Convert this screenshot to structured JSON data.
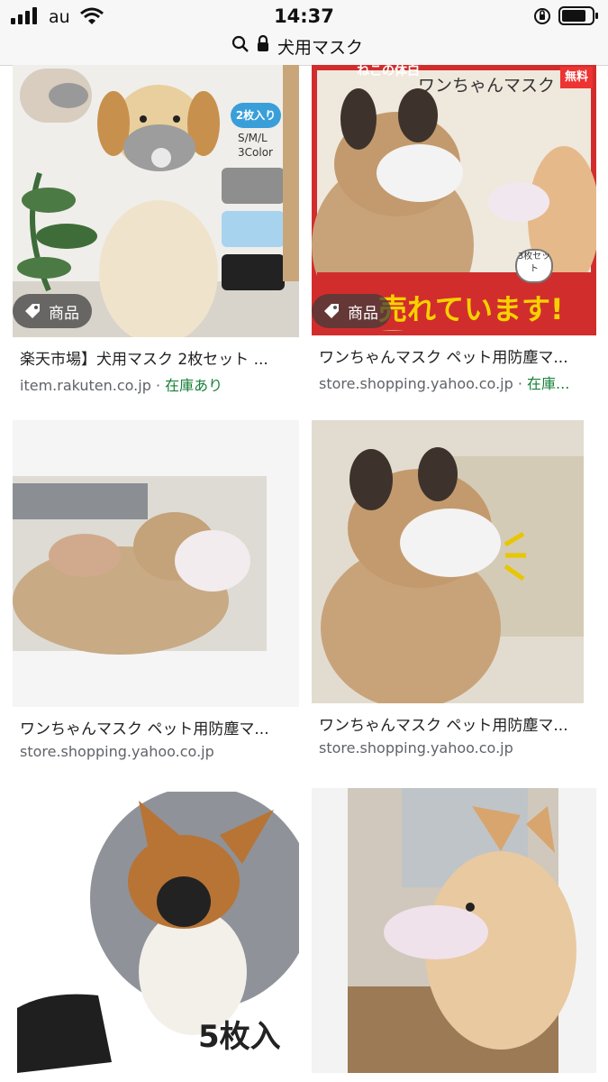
{
  "status_bar": {
    "carrier": "au",
    "time": "14:37"
  },
  "url_bar": {
    "text": "犬用マスク"
  },
  "results": [
    {
      "tag": "商品",
      "title": "楽天市場】犬用マスク 2枚セット ...",
      "source": "item.rakuten.co.jp",
      "stock": "在庫あり",
      "image_text": [
        "2枚入り",
        "S/M/L",
        "3Color"
      ]
    },
    {
      "tag": "商品",
      "title": "ワンちゃんマスク ペット用防塵マ...",
      "source": "store.shopping.yahoo.co.jp",
      "stock": "在庫...",
      "image_text": [
        "ねこの体白",
        "ワンちゃんマスク",
        "無料",
        "売れています!",
        "3枚セット"
      ]
    },
    {
      "title": "ワンちゃんマスク ペット用防塵マ...",
      "source": "store.shopping.yahoo.co.jp"
    },
    {
      "title": "ワンちゃんマスク ペット用防塵マ...",
      "source": "store.shopping.yahoo.co.jp"
    },
    {
      "image_text": [
        "5枚入"
      ]
    },
    {}
  ],
  "colors": {
    "status_bg": "#f7f7f7",
    "meta_gray": "#5f6368",
    "stock_green": "#188038",
    "chip_bg": "rgba(60,60,60,0.72)"
  }
}
